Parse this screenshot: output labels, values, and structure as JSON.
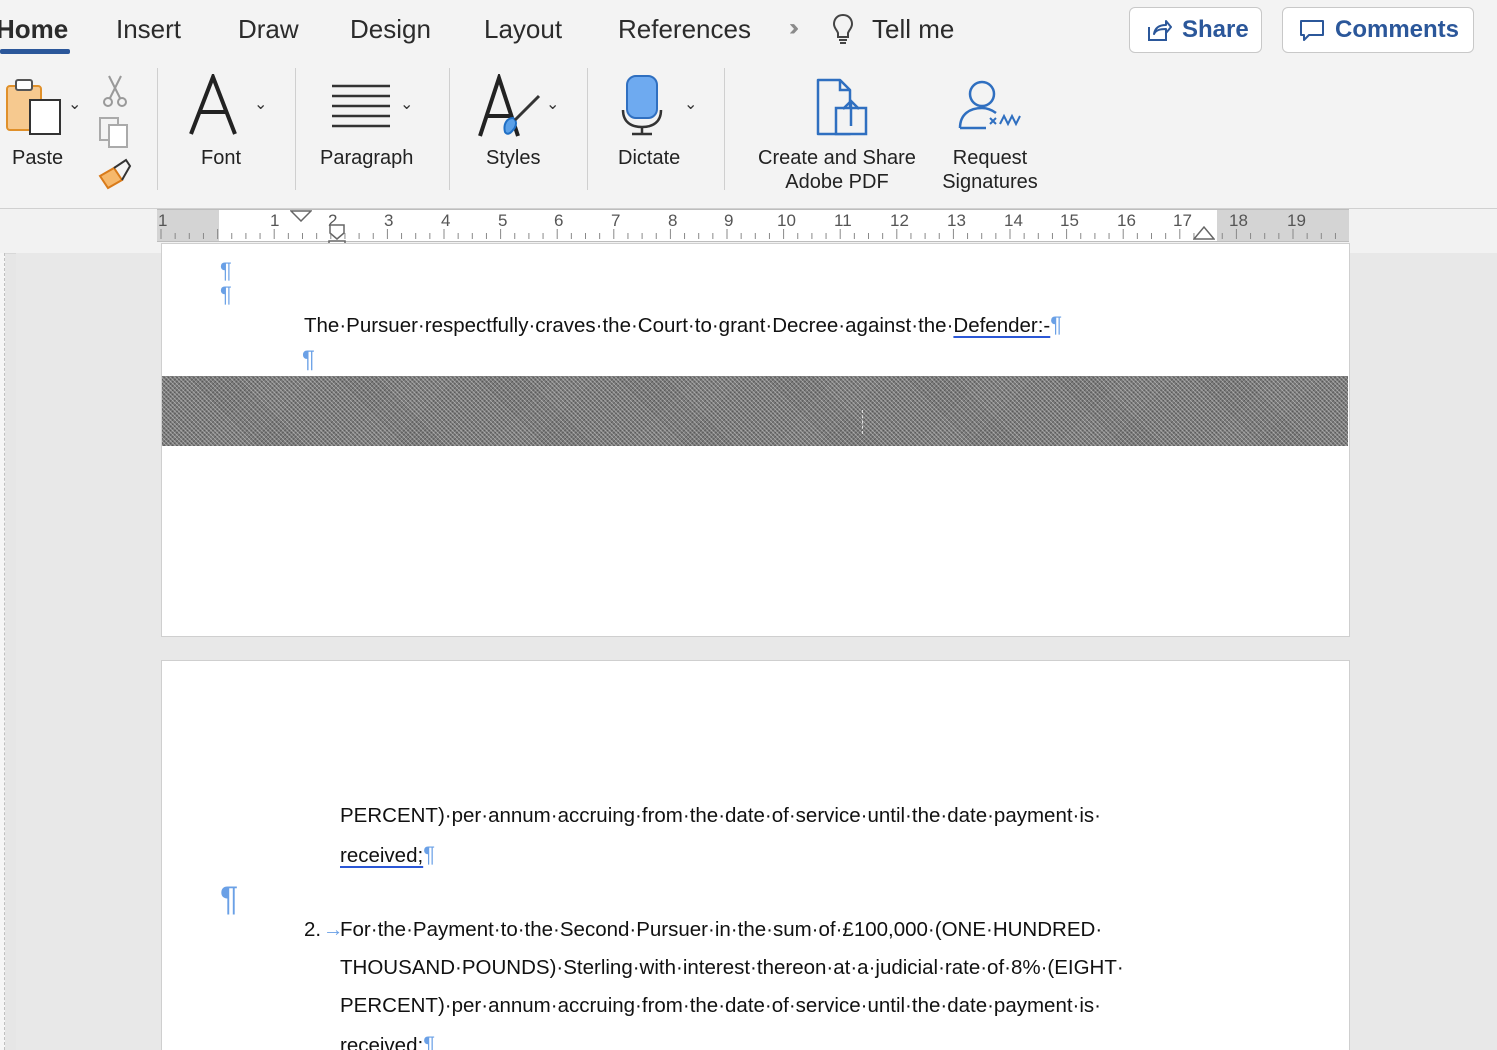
{
  "tabs": [
    {
      "label": "Home",
      "active": true
    },
    {
      "label": "Insert"
    },
    {
      "label": "Draw"
    },
    {
      "label": "Design"
    },
    {
      "label": "Layout"
    },
    {
      "label": "References"
    }
  ],
  "tell_me": "Tell me",
  "share_label": "Share",
  "comments_label": "Comments",
  "ribbon": {
    "paste": "Paste",
    "font": "Font",
    "paragraph": "Paragraph",
    "styles": "Styles",
    "dictate": "Dictate",
    "adobe_line1": "Create and Share",
    "adobe_line2": "Adobe PDF",
    "sign_line1": "Request",
    "sign_line2": "Signatures"
  },
  "ruler_numbers": [
    "1",
    "1",
    "2",
    "3",
    "4",
    "5",
    "6",
    "7",
    "8",
    "9",
    "10",
    "11",
    "12",
    "13",
    "14",
    "15",
    "16",
    "17",
    "18",
    "19"
  ],
  "page1": {
    "pilcrow": "¶",
    "crave_text": "The·Pursuer·respectfully·craves·the·Court·to·grant·Decree·against·the·",
    "crave_underlined": "Defender:-"
  },
  "page2": {
    "line_a": "PERCENT)·per·annum·accruing·from·the·date·of·service·until·the·date·payment·is·",
    "line_b": "received;",
    "item_number": "2.",
    "arrow": "→",
    "item_lines": [
      "For·the·Payment·to·the·Second·Pursuer·in·the·sum·of·£100,000·(ONE·HUNDRED·",
      "THOUSAND·POUNDS)·Sterling·with·interest·thereon·at·a·judicial·rate·of·8%·(EIGHT·",
      "PERCENT)·per·annum·accruing·from·the·date·of·service·until·the·date·payment·is·",
      "received;"
    ]
  },
  "colors": {
    "accent": "#2b579a",
    "pilcrow": "#6aa0e6",
    "share_text": "#2b579a"
  }
}
